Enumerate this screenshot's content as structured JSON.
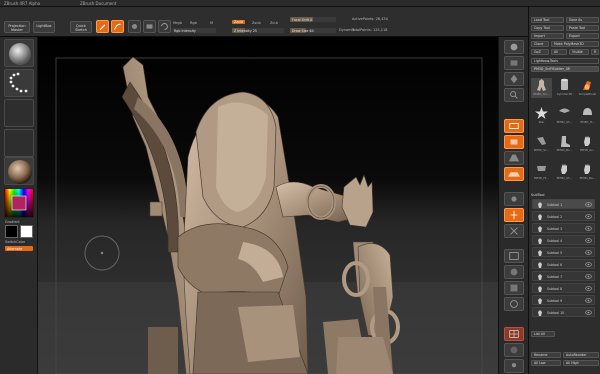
{
  "titlebar": {
    "left_text": "ZBrush 4R7 Alpha",
    "doc_name": "ZBrush Document",
    "mem": "Free Mem 17.4GB",
    "active_mem": "Active Mem 1058",
    "scratch": "Scratch Disk 48",
    "timer": "Timer 0.001"
  },
  "toolbar": {
    "projection_master": "Projection Master",
    "lightbox": "LightBox",
    "quick_sketch": "Quick Sketch",
    "edit": "Edit",
    "draw": "Draw",
    "move": "Move",
    "scale": "Scale",
    "rotate": "Rotate",
    "mrgb": "Mrgb",
    "rgb": "Rgb",
    "m": "M",
    "zadd": "Zadd",
    "zsub": "Zsub",
    "zcut": "Zcut",
    "rgb_intensity": "Rgb Intensity",
    "z_intensity": "Z Intensity 25",
    "focal_shift": "Focal Shift 0",
    "draw_size": "Draw Size 64",
    "dynamic": "Dynamic",
    "active_points": "ActivePoints: 28,434",
    "total_points": "TotalPoints: 125,118"
  },
  "left_shelf": {
    "gradient_label": "Gradient",
    "switch_color_label": "SwitchColor",
    "alternate_label": "Alternate"
  },
  "right_shelf": {
    "buttons": [
      "BPR",
      "SPix 3",
      "Scroll",
      "Zoom",
      "Actual",
      "AAHalf",
      "Persp",
      "Floor",
      "Local",
      "L.Sym",
      "Xpose",
      "Frame",
      "Move",
      "Scale",
      "Rotate",
      "PolyF",
      "Transp",
      "Ghost",
      "Solo",
      "Xpose"
    ]
  },
  "palette": {
    "load_tool": "Load Tool",
    "save_as": "Save As",
    "copy_tool": "Copy Tool",
    "paste_tool": "Paste Tool",
    "import": "Import",
    "export": "Export",
    "clone": "Clone",
    "make_polymesh": "Make PolyMesh3D",
    "goz": "GoZ",
    "all": "All",
    "visible": "Visible",
    "r": "R",
    "lightbox_tools": "Lightbox▸Tools",
    "current_tool": "PM3D_SciFiSoldier_48",
    "tools": [
      {
        "name": "PM3D_Sci...",
        "shape": "figure"
      },
      {
        "name": "Cylinder3D",
        "shape": "cyl"
      },
      {
        "name": "SimpleBrush",
        "shape": "brush"
      },
      {
        "name": "Star",
        "shape": "star"
      },
      {
        "name": "PM3D_Sh...",
        "shape": "shield"
      },
      {
        "name": "PM3D_H...",
        "shape": "helmet"
      },
      {
        "name": "PM3D_Sc...",
        "shape": "arm"
      },
      {
        "name": "PM3D_Bo...",
        "shape": "boot"
      },
      {
        "name": "PM3D_Gl...",
        "shape": "hand"
      },
      {
        "name": "PM3D_Hi...",
        "shape": "hip"
      },
      {
        "name": "PM3D_Sh...",
        "shape": "hand"
      },
      {
        "name": "PM3D_Ba...",
        "shape": "hand"
      }
    ],
    "subtool_header": "SubTool",
    "subtools": [
      "Subtool 1",
      "Subtool 2",
      "Subtool 3",
      "Subtool 4",
      "Subtool 5",
      "Subtool 6",
      "Subtool 7",
      "Subtool 8",
      "Subtool 9",
      "Subtool 10"
    ],
    "list_all": "List All",
    "rename": "Rename",
    "auto_reorder": "AutoReorder",
    "all_low": "All Low",
    "all_high": "All High"
  },
  "colors": {
    "accent": "#e46a16",
    "panel": "#2d2d2d",
    "model": "#b5a08a"
  }
}
